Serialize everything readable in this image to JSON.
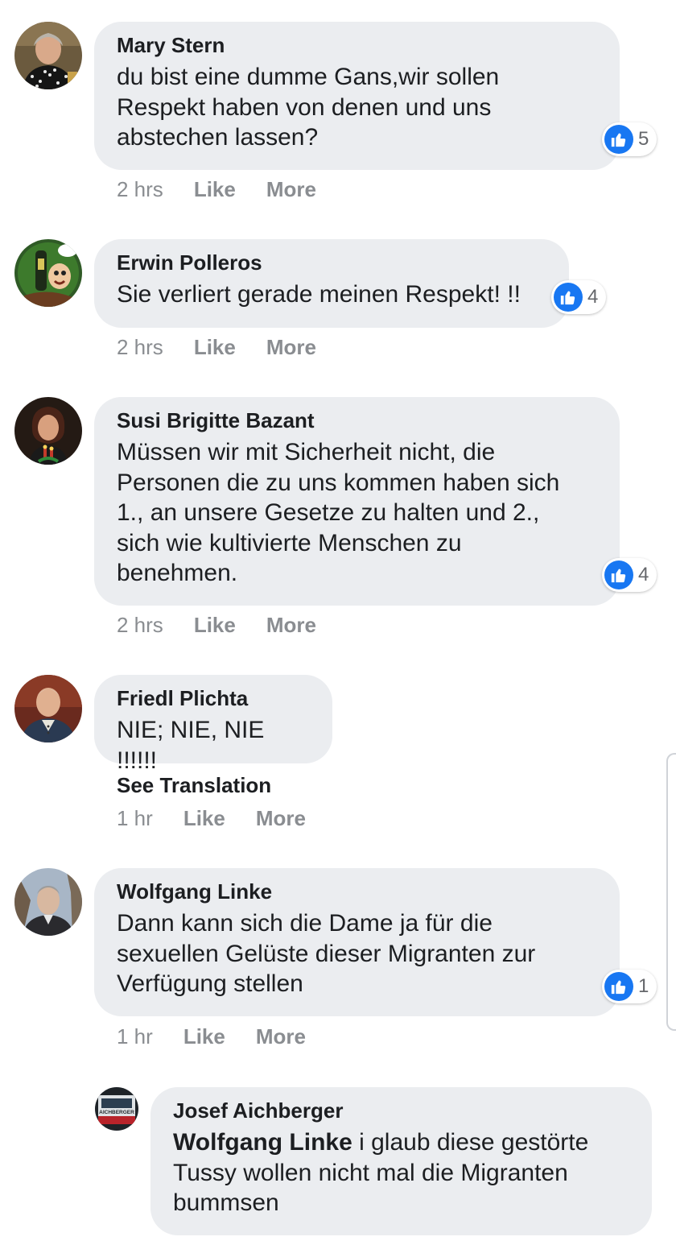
{
  "comments": [
    {
      "author": "Mary Stern",
      "text": "du bist eine dumme Gans,wir sollen\nRespekt haben von denen und uns\nabstechen lassen?",
      "reactions": "5",
      "time": "2 hrs",
      "like": "Like",
      "more": "More"
    },
    {
      "author": "Erwin Polleros",
      "text": "Sie verliert gerade meinen Respekt! !!",
      "reactions": "4",
      "time": "2 hrs",
      "like": "Like",
      "more": "More"
    },
    {
      "author": "Susi Brigitte Bazant",
      "text": "Müssen wir mit Sicherheit nicht, die\nPersonen die zu uns kommen haben sich\n1., an unsere Gesetze zu halten und 2.,\nsich wie kultivierte Menschen zu\nbenehmen.",
      "reactions": "4",
      "time": "2 hrs",
      "like": "Like",
      "more": "More"
    },
    {
      "author": "Friedl Plichta",
      "text": "NIE; NIE, NIE !!!!!!",
      "see_translation": "See Translation",
      "time": "1 hr",
      "like": "Like",
      "more": "More"
    },
    {
      "author": "Wolfgang Linke",
      "text": "Dann kann sich die Dame ja für die\nsexuellen Gelüste dieser Migranten zur\nVerfügung stellen",
      "reactions": "1",
      "time": "1 hr",
      "like": "Like",
      "more": "More"
    }
  ],
  "reply": {
    "author": "Josef Aichberger",
    "mention": "Wolfgang Linke",
    "text": " i glaub diese gestörte\nTussy wollen nicht mal die Migranten\nbummsen",
    "avatar_caption": "AICHBERGER"
  },
  "colors": {
    "bubble": "#ebedf0",
    "like_blue": "#1877f2",
    "meta_gray": "#8a8d91"
  },
  "icons": {
    "reaction": "thumbs-up-icon"
  }
}
